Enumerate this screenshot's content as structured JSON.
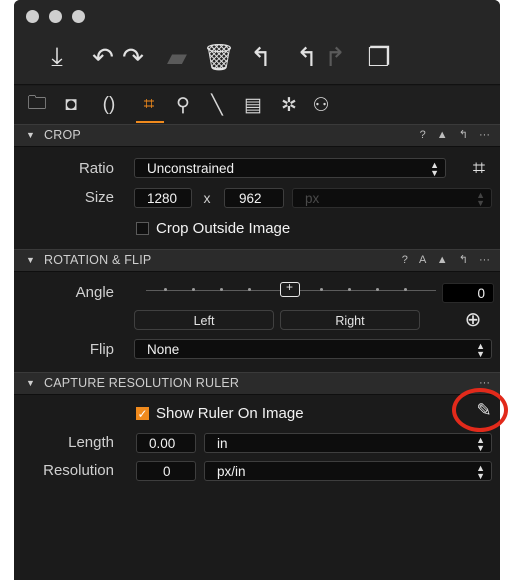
{
  "toolbar": {
    "icons": [
      "import-icon",
      "undo-icon",
      "redo-icon",
      "move-to-icon",
      "trash-icon",
      "reset-icon",
      "back-icon",
      "forward-icon",
      "sets-icon"
    ]
  },
  "tabs": [
    "library",
    "capture",
    "lens",
    "crop",
    "loupe",
    "pick",
    "annotations",
    "settings",
    "adjustments"
  ],
  "sections": {
    "crop": {
      "title": "CROP",
      "header_icons": [
        "?",
        "▲",
        "↰",
        "···"
      ],
      "ratio_label": "Ratio",
      "ratio_value": "Unconstrained",
      "size_label": "Size",
      "width": "1280",
      "x": "x",
      "height": "962",
      "unit": "px",
      "crop_outside_label": "Crop Outside Image",
      "crop_outside_checked": false
    },
    "rotation": {
      "title": "ROTATION & FLIP",
      "header_icons": [
        "?",
        "A",
        "▲",
        "↰",
        "···"
      ],
      "angle_label": "Angle",
      "angle_value": "0",
      "left_btn": "Left",
      "right_btn": "Right",
      "flip_label": "Flip",
      "flip_value": "None"
    },
    "ruler": {
      "title": "CAPTURE RESOLUTION RULER",
      "header_icons": [
        "···"
      ],
      "show_ruler_label": "Show Ruler On Image",
      "show_ruler_checked": true,
      "length_label": "Length",
      "length_value": "0.00",
      "length_unit": "in",
      "resolution_label": "Resolution",
      "resolution_value": "0",
      "resolution_unit": "px/in"
    }
  },
  "colors": {
    "accent": "#f08a1d",
    "highlight_ring": "#e22a1b",
    "panel": "#1b1b1b"
  }
}
